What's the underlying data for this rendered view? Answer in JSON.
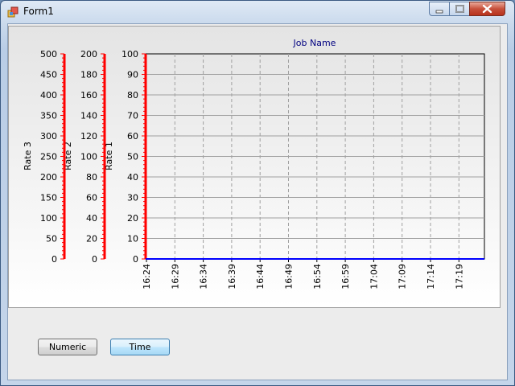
{
  "window": {
    "title": "Form1"
  },
  "buttons": {
    "numeric": "Numeric",
    "time": "Time"
  },
  "colors": {
    "axis_red": "#ff0000",
    "series_blue": "#0000ff",
    "title_navy": "#000080",
    "grid": "#a0a0a0"
  },
  "chart_data": {
    "type": "line",
    "title": "Job Name",
    "x_ticks": [
      "16:24",
      "16:29",
      "16:34",
      "16:39",
      "16:44",
      "16:49",
      "16:54",
      "16:59",
      "17:04",
      "17:09",
      "17:14",
      "17:19"
    ],
    "axes": [
      {
        "label": "Rate 1",
        "ticks": [
          "100",
          "90",
          "80",
          "70",
          "60",
          "50",
          "40",
          "30",
          "20",
          "10",
          "0"
        ],
        "ylim": [
          0,
          100
        ]
      },
      {
        "label": "Rate 2",
        "ticks": [
          "200",
          "180",
          "160",
          "140",
          "120",
          "100",
          "80",
          "60",
          "40",
          "20",
          "0"
        ],
        "ylim": [
          0,
          200
        ]
      },
      {
        "label": "Rate 3",
        "ticks": [
          "500",
          "450",
          "400",
          "350",
          "300",
          "250",
          "200",
          "150",
          "100",
          "50",
          "0"
        ],
        "ylim": [
          0,
          500
        ]
      }
    ],
    "series": [
      {
        "values": [
          0,
          0,
          0,
          0,
          0,
          0,
          0,
          0,
          0,
          0,
          0,
          0
        ]
      }
    ],
    "grid": true
  }
}
